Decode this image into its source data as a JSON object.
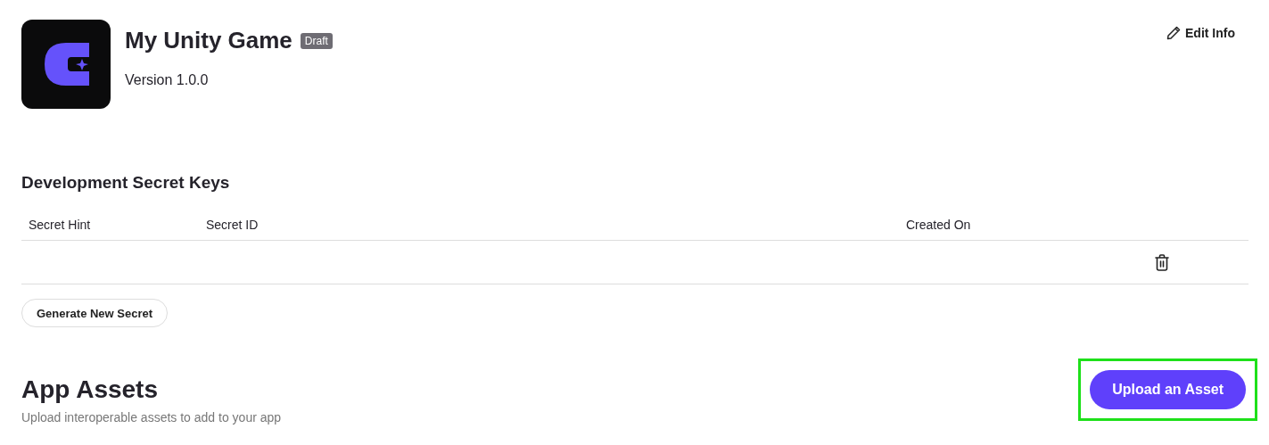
{
  "app": {
    "name": "My Unity Game",
    "status": "Draft",
    "version": "Version 1.0.0"
  },
  "edit_button": {
    "label": "Edit Info"
  },
  "secret_keys": {
    "title": "Development Secret Keys",
    "columns": [
      "Secret Hint",
      "Secret ID",
      "Created On"
    ],
    "rows": [
      {
        "hint": "",
        "id": "",
        "created_on": ""
      }
    ],
    "generate_button": {
      "label": "Generate New Secret"
    }
  },
  "assets": {
    "title": "App Assets",
    "subtitle": "Upload interoperable assets to add to your app",
    "upload_button": {
      "label": "Upload an Asset",
      "highlighted": true
    }
  }
}
